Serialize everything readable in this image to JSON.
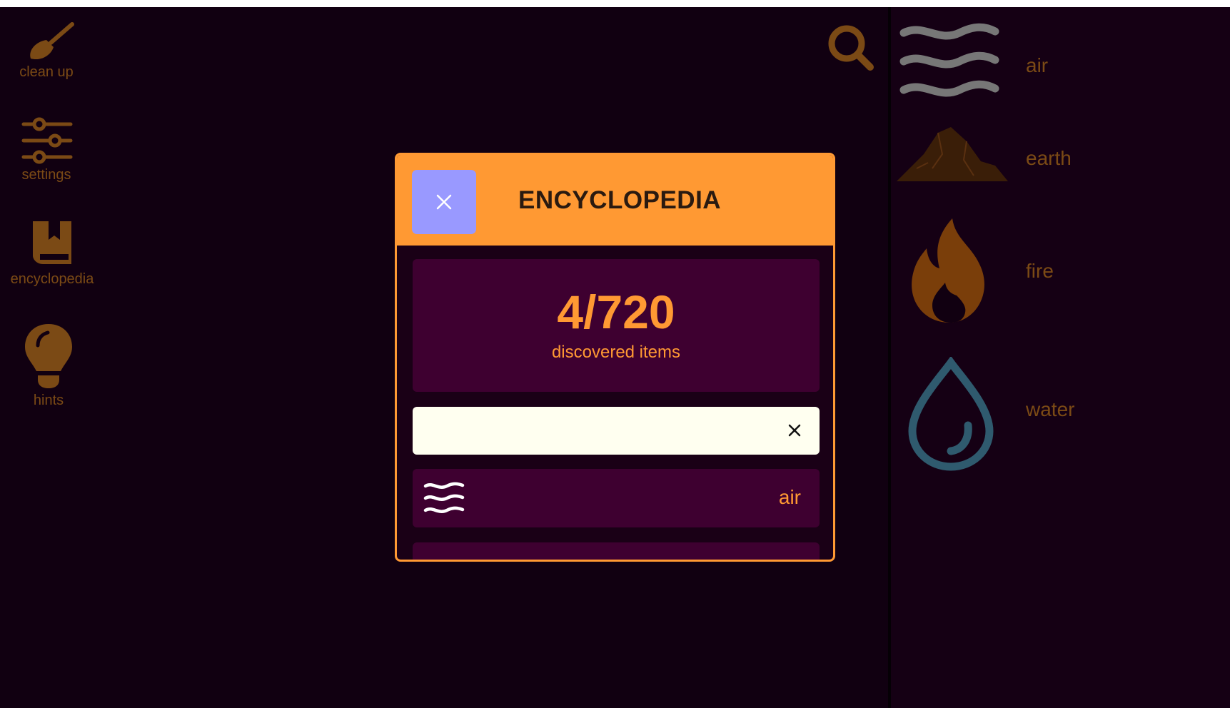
{
  "toolbar": {
    "cleanup_label": "clean up",
    "settings_label": "settings",
    "encyclopedia_label": "encyclopedia",
    "hints_label": "hints"
  },
  "elements": [
    {
      "name": "air",
      "icon": "air-waves-icon"
    },
    {
      "name": "earth",
      "icon": "mountain-icon"
    },
    {
      "name": "fire",
      "icon": "flame-icon"
    },
    {
      "name": "water",
      "icon": "water-drop-icon"
    }
  ],
  "encyclopedia": {
    "title": "ENCYCLOPEDIA",
    "count": "4/720",
    "count_label": "discovered items",
    "search_value": "",
    "items": [
      {
        "name": "air",
        "icon": "air-waves-icon"
      },
      {
        "name": "",
        "icon": ""
      }
    ]
  },
  "colors": {
    "background": "#110011",
    "panel": "#150014",
    "accent": "#ff9933",
    "close_button": "#9999ff",
    "dim_icon": "#7b4a15"
  }
}
